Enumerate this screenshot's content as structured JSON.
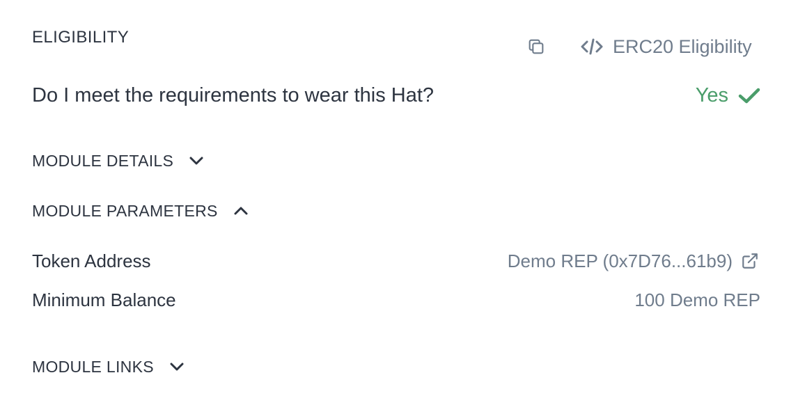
{
  "header": {
    "title": "ELIGIBILITY",
    "copy_icon": "copy-icon",
    "module_type_icon": "code-icon",
    "module_type_label": "ERC20 Eligibility"
  },
  "requirement": {
    "question": "Do I meet the requirements to wear this Hat?",
    "answer": "Yes",
    "answer_icon": "check-icon"
  },
  "sections": {
    "details": {
      "label": "MODULE DETAILS",
      "state": "collapsed",
      "icon": "chevron-down-icon"
    },
    "parameters": {
      "label": "MODULE PARAMETERS",
      "state": "expanded",
      "icon": "chevron-up-icon"
    },
    "links": {
      "label": "MODULE LINKS",
      "state": "collapsed",
      "icon": "chevron-down-icon"
    }
  },
  "parameters": [
    {
      "label": "Token Address",
      "value": "Demo REP (0x7D76...61b9)",
      "icon": "external-link-icon"
    },
    {
      "label": "Minimum Balance",
      "value": "100 Demo REP"
    }
  ],
  "colors": {
    "text": "#2d3440",
    "muted": "#6f7c8c",
    "success": "#4a9d6a"
  }
}
